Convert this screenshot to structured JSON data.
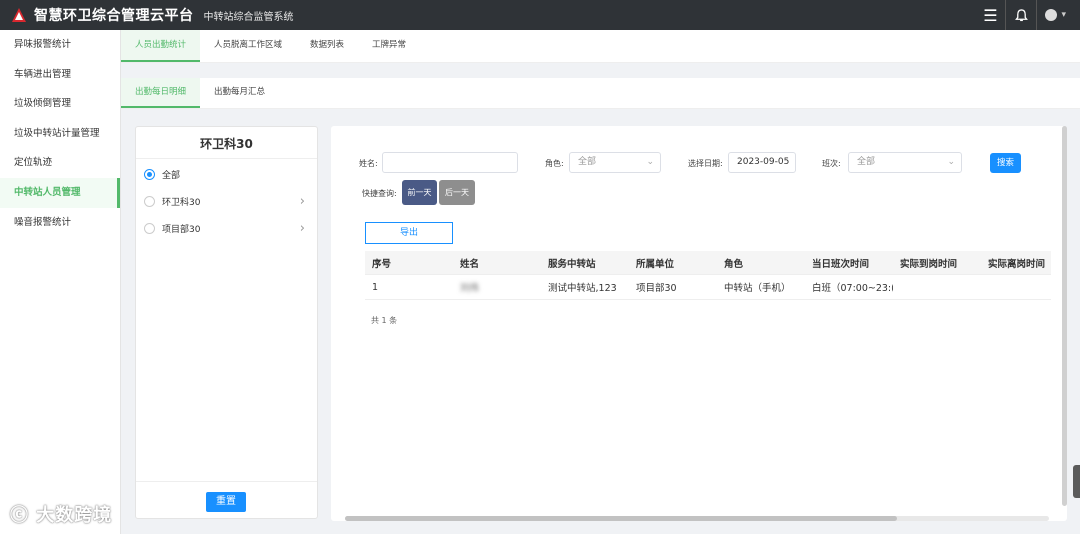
{
  "header": {
    "app_title": "智慧环卫综合管理云平台",
    "sub_title": "中转站综合监管系统",
    "menu_icon": "menu-icon",
    "bell_icon": "bell-icon",
    "user_icon": "user-icon"
  },
  "sidebar": {
    "items": [
      {
        "label": "异味报警统计"
      },
      {
        "label": "车辆进出管理"
      },
      {
        "label": "垃圾倾倒管理"
      },
      {
        "label": "垃圾中转站计量管理"
      },
      {
        "label": "定位轨迹"
      },
      {
        "label": "中转站人员管理"
      },
      {
        "label": "噪音报警统计"
      }
    ],
    "active_index": 5
  },
  "tabs": [
    "人员出勤统计",
    "人员脱离工作区域",
    "数据列表",
    "工牌异常"
  ],
  "subtabs": [
    "出勤每日明细",
    "出勤每月汇总"
  ],
  "tree": {
    "title": "环卫科30",
    "items": [
      {
        "label": "全部"
      },
      {
        "label": "环卫科30"
      },
      {
        "label": "项目部30"
      }
    ],
    "reset_label": "重置"
  },
  "filters": {
    "name_label": "姓名:",
    "name_value": "",
    "role_label": "角色:",
    "role_value": "全部",
    "date_label": "选择日期:",
    "date_value": "2023-09-05",
    "shift_label": "班次:",
    "shift_value": "全部",
    "search_label": "搜索",
    "quick_label": "快捷查询:",
    "prev_day": "前一天",
    "next_day": "后一天",
    "export_label": "导出"
  },
  "table": {
    "columns": [
      "序号",
      "姓名",
      "服务中转站",
      "所属单位",
      "角色",
      "当日班次时间",
      "实际到岗时间",
      "实际离岗时间"
    ],
    "rows": [
      [
        "1",
        "刘伟",
        "测试中转站,123",
        "项目部30",
        "中转站（手机）",
        "白班（07:00~23:(",
        "",
        ""
      ]
    ],
    "total_text": "共 1 条"
  },
  "watermark": "大数跨境",
  "colors": {
    "header_bg": "#2f3337",
    "accent_green": "#52b96a",
    "primary_blue": "#1890ff"
  }
}
